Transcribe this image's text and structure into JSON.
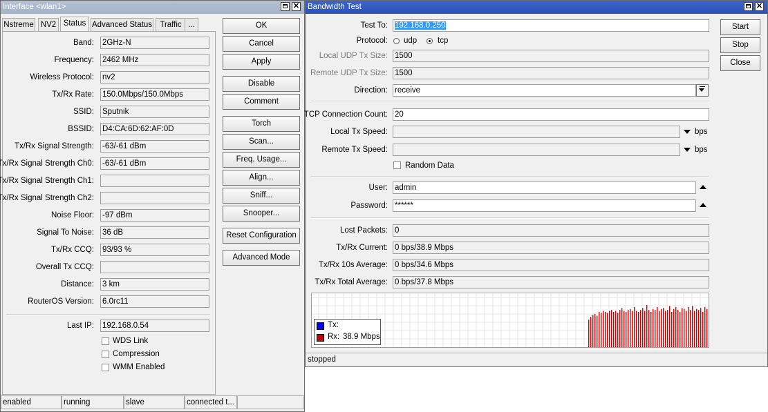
{
  "left_window": {
    "title": "Interface <wlan1>",
    "tabs": [
      "Nstreme",
      "NV2",
      "Status",
      "Advanced Status",
      "Traffic",
      "..."
    ],
    "fields": [
      {
        "label": "Band:",
        "value": "2GHz-N"
      },
      {
        "label": "Frequency:",
        "value": "2462 MHz"
      },
      {
        "label": "Wireless Protocol:",
        "value": "nv2"
      },
      {
        "label": "Tx/Rx Rate:",
        "value": "150.0Mbps/150.0Mbps"
      },
      {
        "label": "SSID:",
        "value": "Sputnik"
      },
      {
        "label": "BSSID:",
        "value": "D4:CA:6D:62:AF:0D"
      },
      {
        "label": "Tx/Rx Signal Strength:",
        "value": "-63/-61 dBm"
      },
      {
        "label": "Tx/Rx Signal Strength Ch0:",
        "value": "-63/-61 dBm"
      },
      {
        "label": "Tx/Rx Signal Strength Ch1:",
        "value": ""
      },
      {
        "label": "Tx/Rx Signal Strength Ch2:",
        "value": ""
      },
      {
        "label": "Noise Floor:",
        "value": "-97 dBm"
      },
      {
        "label": "Signal To Noise:",
        "value": "36 dB"
      },
      {
        "label": "Tx/Rx CCQ:",
        "value": "93/93 %"
      },
      {
        "label": "Overall Tx CCQ:",
        "value": ""
      },
      {
        "label": "Distance:",
        "value": "3 km"
      },
      {
        "label": "RouterOS Version:",
        "value": "6.0rc11"
      }
    ],
    "last_ip": {
      "label": "Last IP:",
      "value": "192.168.0.54"
    },
    "checkboxes": [
      "WDS Link",
      "Compression",
      "WMM Enabled"
    ],
    "buttons": [
      "OK",
      "Cancel",
      "Apply",
      "Disable",
      "Comment",
      "Torch",
      "Scan...",
      "Freq. Usage...",
      "Align...",
      "Sniff...",
      "Snooper...",
      "Reset Configuration",
      "Advanced Mode"
    ],
    "status_bar": [
      "enabled",
      "running",
      "slave",
      "connected t..."
    ]
  },
  "right_window": {
    "title": "Bandwidth Test",
    "test_to": {
      "label": "Test To:",
      "value": "192.168.0.250"
    },
    "protocol": {
      "label": "Protocol:",
      "options": [
        "udp",
        "tcp"
      ],
      "selected": "tcp"
    },
    "local_udp": {
      "label": "Local UDP Tx Size:",
      "value": "1500"
    },
    "remote_udp": {
      "label": "Remote UDP Tx Size:",
      "value": "1500"
    },
    "direction": {
      "label": "Direction:",
      "value": "receive"
    },
    "tcp_count": {
      "label": "TCP Connection Count:",
      "value": "20"
    },
    "local_speed": {
      "label": "Local Tx Speed:",
      "value": "",
      "unit": "bps"
    },
    "remote_speed": {
      "label": "Remote Tx Speed:",
      "value": "",
      "unit": "bps"
    },
    "random_data": "Random Data",
    "user": {
      "label": "User:",
      "value": "admin"
    },
    "password": {
      "label": "Password:",
      "value": "******"
    },
    "lost_packets": {
      "label": "Lost Packets:",
      "value": "0"
    },
    "current": {
      "label": "Tx/Rx Current:",
      "value": "0 bps/38.9 Mbps"
    },
    "avg10": {
      "label": "Tx/Rx 10s Average:",
      "value": "0 bps/34.6 Mbps"
    },
    "total_avg": {
      "label": "Tx/Rx Total Average:",
      "value": "0 bps/37.8 Mbps"
    },
    "legend": {
      "tx_label": "Tx:",
      "rx_label": "Rx:",
      "rx_value": "38.9 Mbps",
      "tx_color": "#0000ff",
      "rx_color": "#cc0000"
    },
    "buttons": [
      "Start",
      "Stop",
      "Close"
    ],
    "status": "stopped"
  },
  "chart_data": {
    "type": "bar",
    "series": [
      {
        "name": "Tx",
        "values": [
          0,
          0,
          0,
          0,
          0,
          0,
          0,
          0,
          0,
          0,
          0,
          0,
          0,
          0,
          0,
          0,
          0,
          0,
          0,
          0,
          0,
          0,
          0,
          0,
          0,
          0,
          0,
          0,
          0,
          0,
          0,
          0,
          0,
          0,
          0,
          0,
          0,
          0,
          0,
          0,
          0,
          0,
          0,
          0,
          0,
          0,
          0,
          0,
          0,
          0,
          0,
          0,
          0,
          0,
          0,
          0,
          0,
          0,
          0,
          0,
          0,
          0,
          0,
          0,
          0,
          0,
          0,
          0,
          0,
          0,
          0,
          0,
          0,
          0,
          0,
          0,
          0,
          0,
          0,
          0,
          0,
          0,
          0,
          0,
          0,
          0,
          0,
          0,
          0,
          0
        ]
      },
      {
        "name": "Rx",
        "values": [
          0,
          0,
          0,
          0,
          0,
          0,
          0,
          0,
          0,
          0,
          0,
          0,
          0,
          0,
          0,
          0,
          0,
          0,
          0,
          0,
          0,
          0,
          0,
          0,
          0,
          0,
          0,
          0,
          0,
          0,
          0,
          0,
          0,
          0,
          0,
          0,
          0,
          0,
          0,
          0,
          0,
          0,
          0,
          0,
          0,
          0,
          0,
          0,
          0,
          0,
          0,
          0,
          0,
          0,
          0,
          0,
          0,
          0,
          0,
          0,
          0,
          0,
          0,
          0,
          0,
          0,
          0,
          0,
          0,
          0,
          0,
          0,
          0,
          0,
          0,
          0,
          0,
          0,
          0,
          0,
          0,
          0,
          0,
          0,
          0,
          0,
          0,
          0,
          0,
          0,
          0,
          0,
          0,
          0,
          0,
          0,
          0,
          0,
          0,
          0,
          0,
          0,
          0,
          0,
          0,
          0,
          0,
          0,
          0,
          0,
          0,
          0,
          0,
          0,
          0,
          0,
          0,
          0,
          0,
          0,
          0,
          0,
          0,
          0,
          0,
          0,
          0,
          0,
          0,
          0,
          0,
          0,
          0,
          0,
          0,
          0,
          0,
          0,
          0,
          0,
          0,
          0,
          0,
          0,
          0,
          0,
          0,
          0,
          0,
          0,
          0,
          0,
          0,
          0,
          0,
          28,
          31,
          33,
          34,
          32,
          36,
          35,
          37,
          36,
          35,
          37,
          38,
          36,
          37,
          35,
          38,
          40,
          37,
          36,
          38,
          39,
          37,
          41,
          37,
          36,
          38,
          40,
          37,
          43,
          38,
          36,
          39,
          38,
          41,
          37,
          39,
          40,
          37,
          38,
          42,
          36,
          39,
          41,
          38,
          36,
          40,
          39,
          37,
          41,
          38,
          42,
          37,
          39,
          38,
          40,
          36,
          41,
          39
        ]
      }
    ],
    "ylim": [
      0,
      55
    ]
  }
}
